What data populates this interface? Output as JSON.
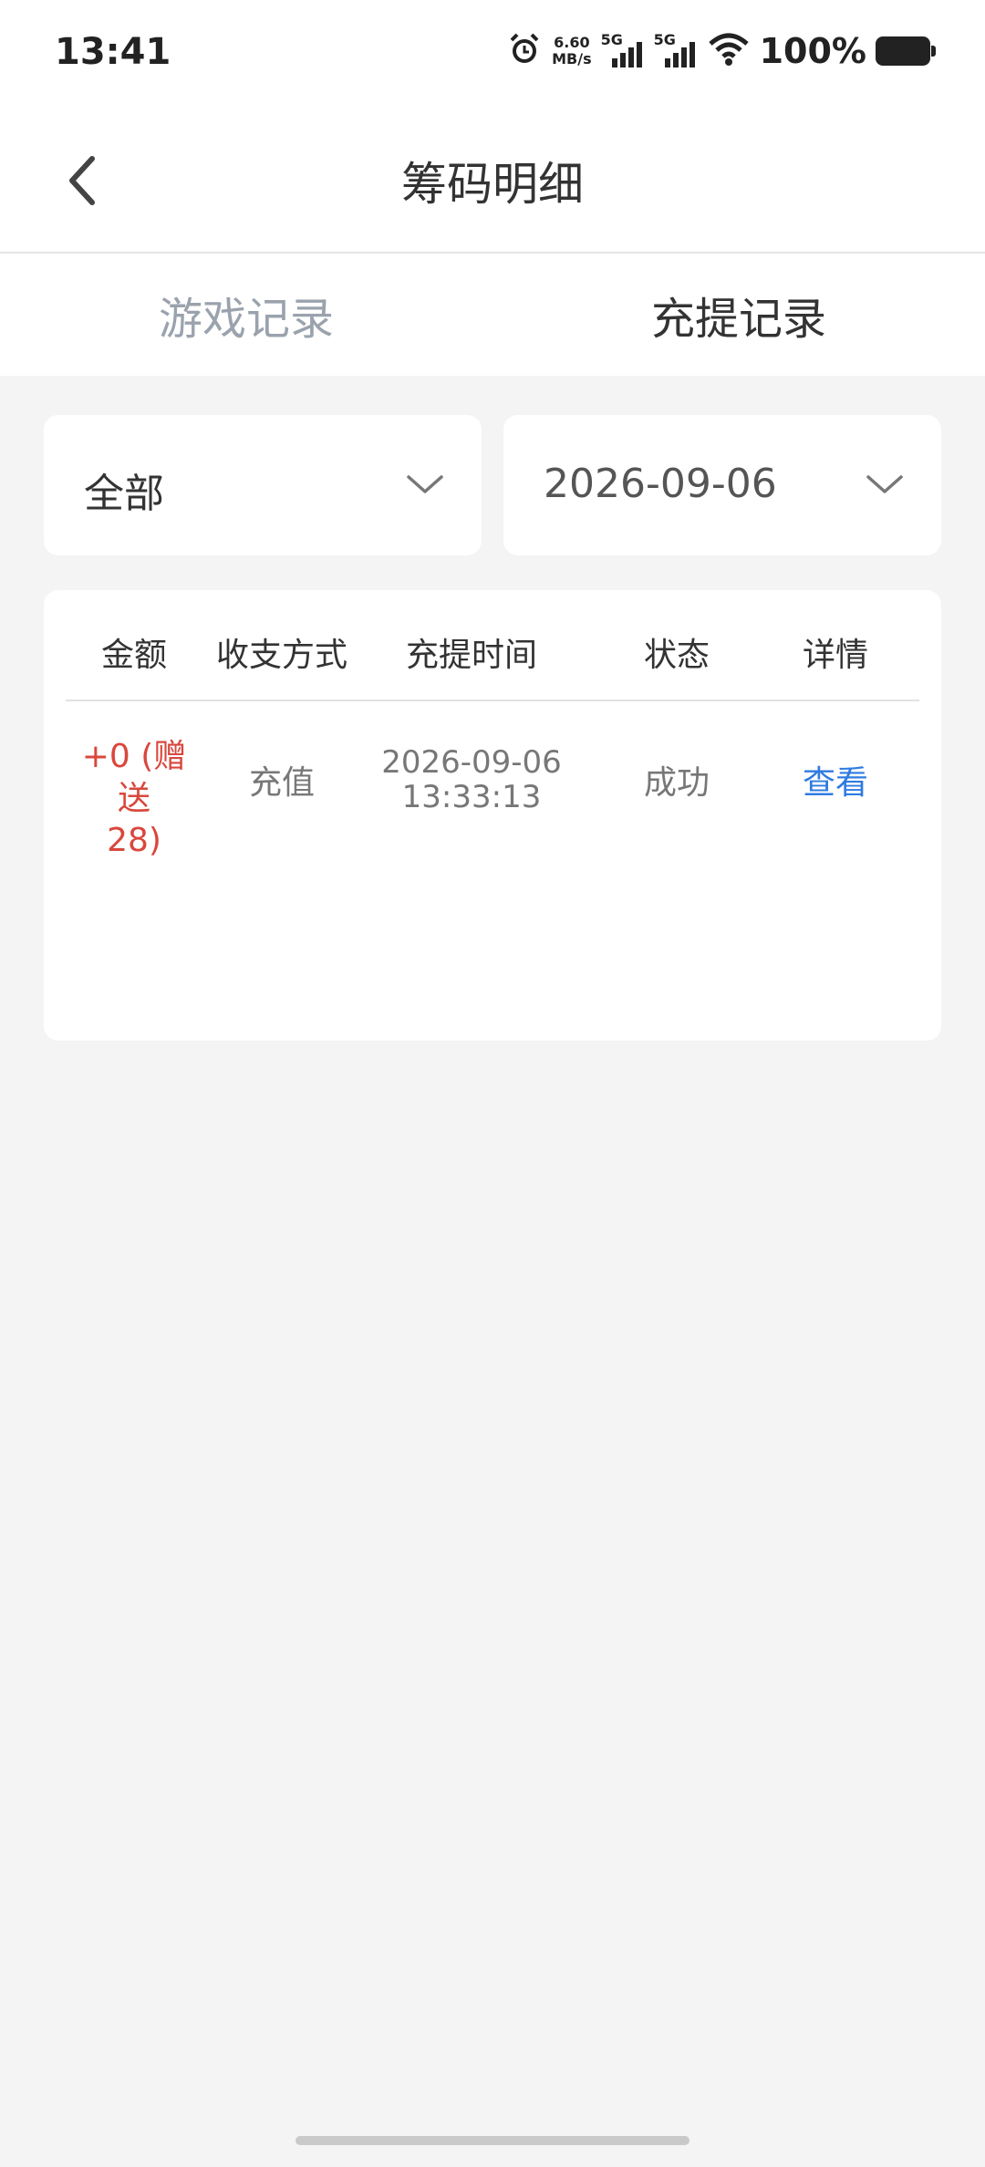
{
  "status_bar": {
    "time": "13:41",
    "net_speed_value": "6.60",
    "net_speed_unit": "MB/s",
    "sim1_label": "5G",
    "sim2_label": "5G",
    "battery_text": "100%",
    "icons": [
      "alarm-icon",
      "signal-icon",
      "wifi-icon",
      "battery-icon"
    ]
  },
  "header": {
    "title": "筹码明细",
    "back_icon": "chevron-left-icon"
  },
  "tabs": [
    {
      "label": "游戏记录",
      "active": false
    },
    {
      "label": "充提记录",
      "active": true
    }
  ],
  "filters": {
    "type": {
      "value": "全部"
    },
    "date": {
      "value": "2026-09-06"
    }
  },
  "table": {
    "columns": [
      "金额",
      "收支方式",
      "充提时间",
      "状态",
      "详情"
    ],
    "rows": [
      {
        "amount_line1": "+0 (赠送",
        "amount_line2": "28)",
        "method": "充值",
        "date": "2026-09-06",
        "time": "13:33:13",
        "status": "成功",
        "detail": "查看"
      }
    ]
  },
  "colors": {
    "amount": "#d9473d",
    "link": "#2f7be0",
    "tab_inactive": "#9aa3ad",
    "background": "#f4f4f4"
  }
}
